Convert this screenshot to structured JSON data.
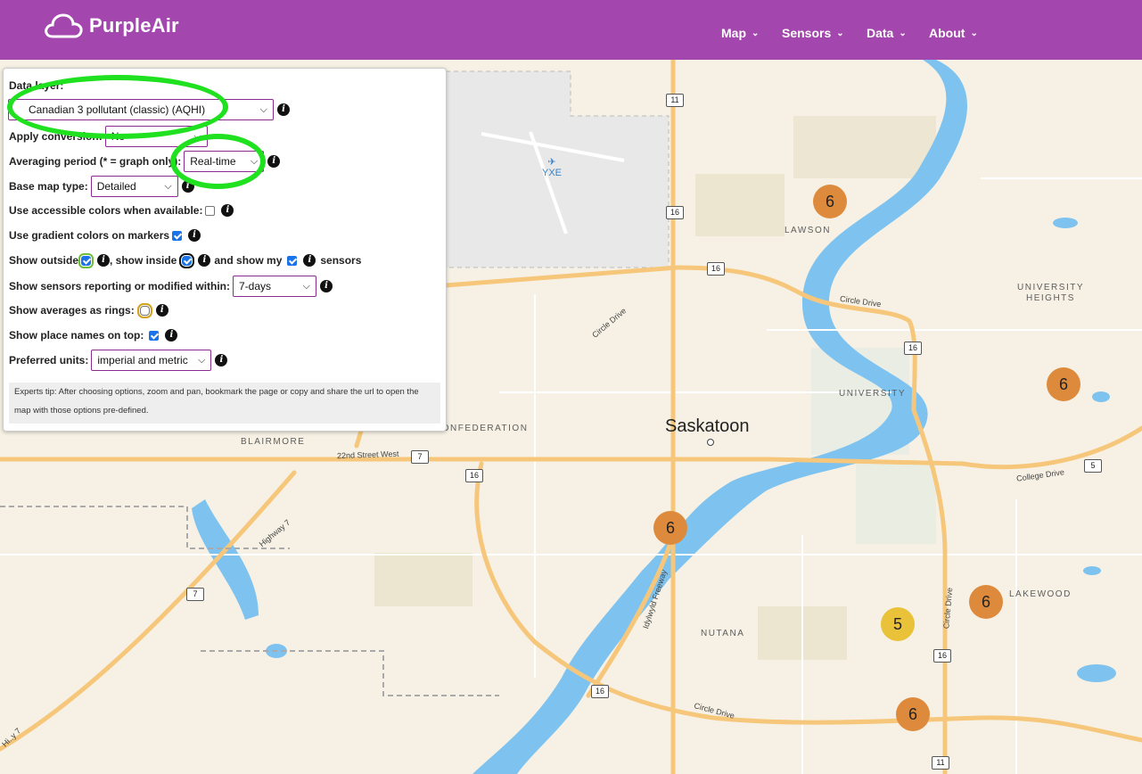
{
  "header": {
    "brand": "PurpleAir",
    "nav": [
      {
        "label": "Map"
      },
      {
        "label": "Sensors"
      },
      {
        "label": "Data"
      },
      {
        "label": "About"
      }
    ]
  },
  "panel": {
    "data_layer_label": "Data layer:",
    "data_layer_value": "Canadian 3 pollutant (classic) (AQHI)",
    "apply_conversion_label": "Apply conversion:",
    "apply_conversion_value": "No",
    "averaging_label": "Averaging period (* = graph only):",
    "averaging_value": "Real-time",
    "base_map_label": "Base map type:",
    "base_map_value": "Detailed",
    "accessible_label": "Use accessible colors when available:",
    "accessible_checked": false,
    "gradient_label": "Use gradient colors on markers",
    "gradient_checked": true,
    "show_outside_label": "Show outside",
    "show_outside_checked": true,
    "show_inside_label": ", show inside",
    "show_inside_checked": true,
    "show_my_label": "and show my",
    "show_my_checked": true,
    "sensors_label": "sensors",
    "reporting_label": "Show sensors reporting or modified within:",
    "reporting_value": "7-days",
    "rings_label": "Show averages as rings:",
    "rings_checked": false,
    "place_names_label": "Show place names on top:",
    "place_names_checked": true,
    "units_label": "Preferred units:",
    "units_value": "imperial and metric",
    "tip_line1": "Experts tip: After choosing options, zoom and pan, bookmark the page or copy and share the url to open the",
    "tip_line2": "map with those options pre-defined."
  },
  "map": {
    "city": "Saskatoon",
    "airport": "YXE",
    "labels": [
      "LAWSON",
      "UNIVERSITY",
      "HEIGHTS",
      "UNIVERSITY",
      "BLAIRMORE",
      "CONFEDERATION",
      "LAKEWOOD",
      "NUTANA"
    ],
    "roads": [
      "Circle Drive",
      "Circle Drive",
      "22nd Street West",
      "College Drive",
      "Highway 7",
      "Idylwyld Freeway",
      "Circle Drive",
      "Circle Drive",
      "Hi..y 7"
    ],
    "shields": [
      "11",
      "16",
      "16",
      "16",
      "7",
      "16",
      "7",
      "16",
      "16",
      "11",
      "5"
    ],
    "clusters": [
      {
        "value": "6",
        "color": "#de8a3c"
      },
      {
        "value": "6",
        "color": "#de8a3c"
      },
      {
        "value": "6",
        "color": "#de8a3c"
      },
      {
        "value": "6",
        "color": "#de8a3c"
      },
      {
        "value": "5",
        "color": "#e9c23a"
      },
      {
        "value": "6",
        "color": "#de8a3c"
      }
    ]
  },
  "colors": {
    "header": "#a347ae",
    "annotation": "#1fe11f",
    "water": "#7ec3ef",
    "road": "#f6c77a"
  }
}
